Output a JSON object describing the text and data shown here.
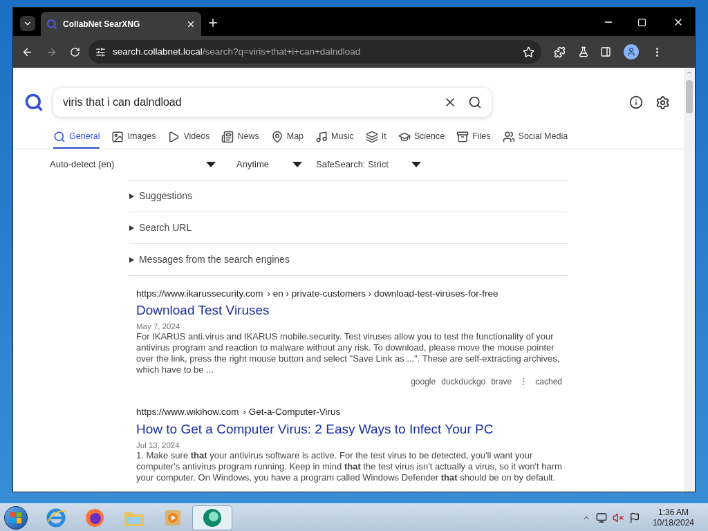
{
  "browser": {
    "tab_title": "CollabNet SearXNG",
    "url_host": "search.collabnet.local",
    "url_path": "/search?q=viris+that+i+can+dalndload"
  },
  "search": {
    "query": "viris that i can dalndload"
  },
  "categories": [
    {
      "label": "General",
      "selected": true
    },
    {
      "label": "Images",
      "selected": false
    },
    {
      "label": "Videos",
      "selected": false
    },
    {
      "label": "News",
      "selected": false
    },
    {
      "label": "Map",
      "selected": false
    },
    {
      "label": "Music",
      "selected": false
    },
    {
      "label": "It",
      "selected": false
    },
    {
      "label": "Science",
      "selected": false
    },
    {
      "label": "Files",
      "selected": false
    },
    {
      "label": "Social Media",
      "selected": false
    }
  ],
  "filters": [
    "Auto-detect (en)",
    "Anytime",
    "SafeSearch: Strict"
  ],
  "sections": [
    {
      "label": "Suggestions",
      "expanded": false
    },
    {
      "label": "Search URL",
      "expanded": false
    },
    {
      "label": "Messages from the search engines",
      "expanded": false
    }
  ],
  "results": [
    {
      "url": "https://www.ikarussecurity.com",
      "path": "› en › private-customers › download-test-viruses-for-free",
      "title": "Download Test Viruses",
      "date": "May 7, 2024",
      "snippet": "For IKARUS anti.virus and IKARUS mobile.security. Test viruses allow you to test the functionality of your antivirus program and reaction to malware without any risk. To download, please move the mouse pointer over the link, press the right mouse button and select \"Save Link as ...\". These are self-extracting archives, which have to be ...",
      "engines": [
        "google",
        "duckduckgo",
        "brave"
      ],
      "cached": "cached"
    },
    {
      "url": "https://www.wikihow.com",
      "path": "› Get-a-Computer-Virus",
      "title": "How to Get a Computer Virus: 2 Easy Ways to Infect Your PC",
      "date": "Jul 13, 2024",
      "snippet": "1. Make sure **that** your antivirus software is active. For the test virus to be detected, you'll want your computer's antivirus program running. Keep in mind **that** the test virus isn't actually a virus, so it won't harm your computer. On Windows, you have a program called Windows Defender **that** should be on by default."
    }
  ],
  "taskbar": {
    "time": "1:36 AM",
    "date": "10/18/2024"
  }
}
